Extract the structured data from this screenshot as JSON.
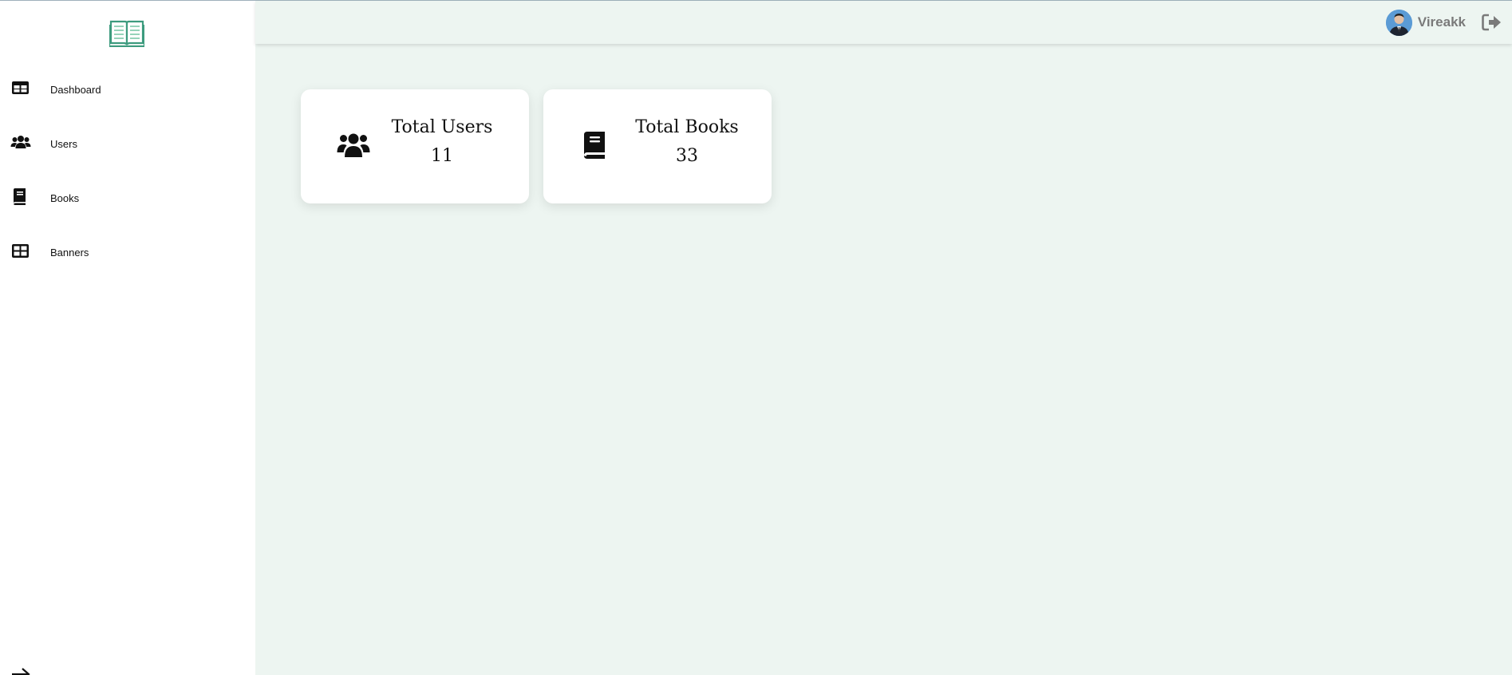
{
  "sidebar": {
    "logo_icon": "open-book-icon",
    "items": [
      {
        "label": "Dashboard",
        "icon": "table-icon"
      },
      {
        "label": "Users",
        "icon": "users-icon"
      },
      {
        "label": "Books",
        "icon": "book-icon"
      },
      {
        "label": "Banners",
        "icon": "grid-icon"
      }
    ],
    "collapse_icon": "arrow-right-icon"
  },
  "header": {
    "user": {
      "name": "Vireakk",
      "avatar_icon": "user-avatar"
    },
    "logout_icon": "sign-out-icon"
  },
  "stats": [
    {
      "title": "Total Users",
      "value": "11",
      "icon": "users-icon"
    },
    {
      "title": "Total Books",
      "value": "33",
      "icon": "book-icon"
    }
  ],
  "colors": {
    "background": "#edf5f1",
    "sidebar": "#ffffff",
    "logo": "#3d9b7e",
    "username": "#7a7a7a"
  }
}
